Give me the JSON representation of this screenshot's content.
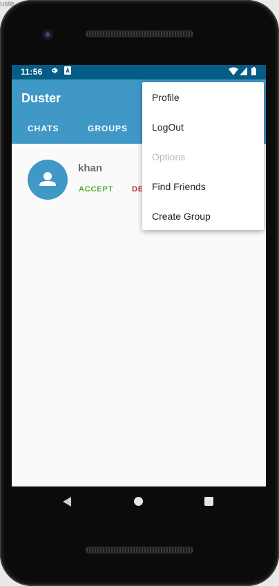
{
  "corner_label": "uste",
  "status_bar": {
    "time": "11:56",
    "icons": [
      "gear-icon",
      "a-box-icon",
      "wifi-icon",
      "signal-icon",
      "battery-icon"
    ]
  },
  "app": {
    "title": "Duster",
    "tabs": [
      "CHATS",
      "GROUPS"
    ]
  },
  "request": {
    "name": "khan",
    "accept_label": "ACCEPT",
    "decline_label": "DE"
  },
  "overflow_menu": {
    "items": [
      {
        "label": "Profile",
        "enabled": true
      },
      {
        "label": "LogOut",
        "enabled": true
      },
      {
        "label": "Options",
        "enabled": false
      },
      {
        "label": "Find Friends",
        "enabled": true
      },
      {
        "label": "Create Group",
        "enabled": true
      }
    ]
  },
  "colors": {
    "status_bar": "#055c85",
    "app_bar": "#4098c7",
    "accept": "#58a630",
    "decline": "#c62828"
  }
}
